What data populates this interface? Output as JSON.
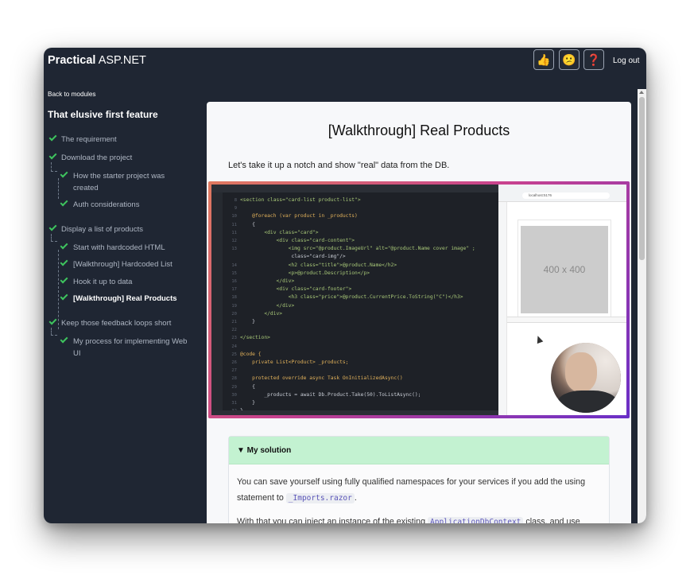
{
  "app": {
    "brand_bold": "Practical",
    "brand_rest": " ASP.NET",
    "logout": "Log out"
  },
  "header_icons": [
    {
      "name": "thumbs-up-icon",
      "glyph": "👍"
    },
    {
      "name": "confused-face-icon",
      "glyph": "😕"
    },
    {
      "name": "help-icon",
      "glyph": "❓"
    }
  ],
  "sidebar": {
    "back": "Back to modules",
    "title": "That elusive first feature",
    "items": [
      {
        "label": "The requirement"
      },
      {
        "label": "Download the project"
      },
      {
        "label": "How the starter project was"
      },
      {
        "label": "created"
      },
      {
        "label": "Auth considerations"
      },
      {
        "label": "Display a list of products"
      },
      {
        "label": "Start with hardcoded HTML"
      },
      {
        "label": "[Walkthrough] Hardcoded List"
      },
      {
        "label": "Hook it up to data"
      },
      {
        "label": "[Walkthrough] Real Products"
      },
      {
        "label": "Keep those feedback loops short"
      },
      {
        "label": "My process for implementing Web"
      },
      {
        "label": "UI"
      }
    ]
  },
  "main": {
    "title": "[Walkthrough] Real Products",
    "intro": "Let's take it up a notch and show \"real\" data from the DB.",
    "video": {
      "placeholder_text": "400 x 400",
      "url": "localhost:5176",
      "code_lines": [
        {
          "n": "8",
          "t": "<section class=\"card-list product-list\">"
        },
        {
          "n": "9",
          "t": ""
        },
        {
          "n": "10",
          "t": "    @foreach (var product in _products)"
        },
        {
          "n": "11",
          "t": "    {"
        },
        {
          "n": "11",
          "t": "        <div class=\"card\">"
        },
        {
          "n": "12",
          "t": "            <div class=\"card-content\">"
        },
        {
          "n": "13",
          "t": "                <img src=\"@product.ImageUrl\" alt=\"@product.Name cover image\" ;"
        },
        {
          "n": "",
          "t": "                 class=\"card-img\"/>"
        },
        {
          "n": "14",
          "t": "                <h2 class=\"title\">@product.Name</h2>"
        },
        {
          "n": "15",
          "t": "                <p>@product.Description</p>"
        },
        {
          "n": "16",
          "t": "            </div>"
        },
        {
          "n": "17",
          "t": "            <div class=\"card-footer\">"
        },
        {
          "n": "18",
          "t": "                <h3 class=\"price\">@product.CurrentPrice.ToString(\"C\")</h3>"
        },
        {
          "n": "19",
          "t": "            </div>"
        },
        {
          "n": "20",
          "t": "        </div>"
        },
        {
          "n": "21",
          "t": "    }"
        },
        {
          "n": "22",
          "t": ""
        },
        {
          "n": "23",
          "t": "</section>"
        },
        {
          "n": "24",
          "t": ""
        },
        {
          "n": "25",
          "t": "@code {"
        },
        {
          "n": "26",
          "t": "    private List<Product> _products;"
        },
        {
          "n": "27",
          "t": ""
        },
        {
          "n": "28",
          "t": "    protected override async Task OnInitializedAsync()"
        },
        {
          "n": "29",
          "t": "    {"
        },
        {
          "n": "30",
          "t": "        _products = await Db.Product.Take(50).ToListAsync();"
        },
        {
          "n": "31",
          "t": "    }"
        },
        {
          "n": "32",
          "t": "}"
        }
      ]
    },
    "solution": {
      "summary": "▼ My solution",
      "p1_a": "You can save yourself using fully qualified namespaces for your services if you add the using",
      "p1_b": "statement to ",
      "p1_code": "_Imports.razor",
      "p1_c": ".",
      "p2_a": "With that you can inject an instance of the existing ",
      "p2_code": "ApplicationDbContext",
      "p2_b": " class, and use"
    }
  },
  "colors": {
    "check": "#3ec45e",
    "sidebar_bg": "#1f2633",
    "solution_header": "#c3f2d1"
  }
}
